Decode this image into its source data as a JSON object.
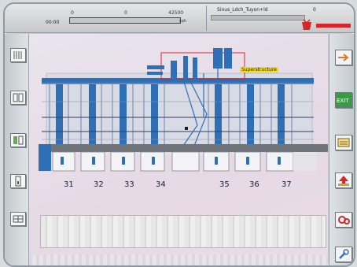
{
  "topbar": {
    "time": "00:00",
    "scale_min": "0",
    "scale_mid": "0",
    "scale_max": "42500",
    "unit": "cph",
    "progress_fraction": 0.0,
    "signal_label": "Sinus_Ldch_Tuyon+ld",
    "signal_value": "0"
  },
  "diagram": {
    "callout": "Superstructure",
    "units": [
      "31",
      "32",
      "33",
      "34",
      "35",
      "36",
      "37"
    ]
  },
  "icons": {
    "left": [
      "stripes-icon",
      "columns-icon",
      "split-icon",
      "single-panel-icon",
      "grid-icon"
    ],
    "right": [
      "arrow-right-icon",
      "exit-icon",
      "list-icon",
      "up-arrow-icon",
      "gears-icon",
      "wrench-icon"
    ],
    "exit_label": "EXIT"
  },
  "colors": {
    "alarm": "#d6262c",
    "structure": "#2f6fb6",
    "accent_red": "#d6262c",
    "highlight": "#f2df1a"
  }
}
